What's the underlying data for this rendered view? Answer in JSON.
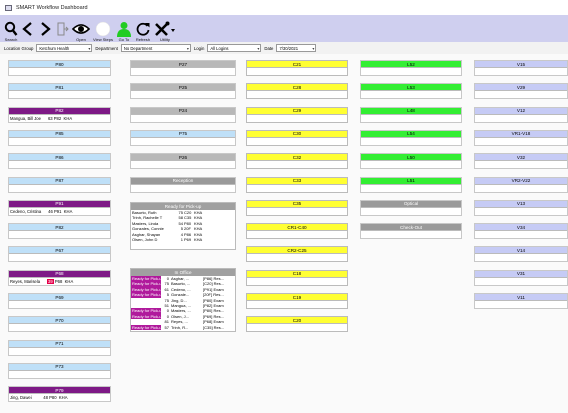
{
  "window": {
    "title": "SMART Workflow Dashboard"
  },
  "toolbar": [
    {
      "name": "search-button",
      "icon": "search-icon",
      "label": "Search"
    },
    {
      "name": "back-button",
      "icon": "chevron-left-icon",
      "label": ""
    },
    {
      "name": "forward-button",
      "icon": "chevron-right-icon",
      "label": ""
    },
    {
      "name": "checkout-button",
      "icon": "door-icon",
      "label": ""
    },
    {
      "name": "open-button",
      "icon": "eye-icon",
      "label": "Open"
    },
    {
      "name": "view-steps-button",
      "icon": "circle-icon",
      "label": "View Steps"
    },
    {
      "name": "go-to-button",
      "icon": "person-icon",
      "label": "Go To"
    },
    {
      "name": "refresh-button",
      "icon": "refresh-icon",
      "label": "Refresh"
    },
    {
      "name": "utility-button",
      "icon": "tools-icon",
      "label": "Utility"
    }
  ],
  "filters": {
    "location_label": "Location Group",
    "location_value": "Ketchum Health",
    "department_label": "Department",
    "department_value": "No Department",
    "login_label": "Login",
    "login_value": "All Logins",
    "date_label": "Date",
    "date_value": "7/30/2021"
  },
  "col1": [
    {
      "name": "P80",
      "color": "blue",
      "detail": ""
    },
    {
      "name": "P81",
      "color": "blue",
      "detail": ""
    },
    {
      "name": "P82",
      "color": "purple",
      "detail": "Mangua, Bill Joe      63 P82  KHA"
    },
    {
      "name": "P85",
      "color": "blue",
      "detail": ""
    },
    {
      "name": "P86",
      "color": "blue",
      "detail": ""
    },
    {
      "name": "P87",
      "color": "blue",
      "detail": ""
    },
    {
      "name": "P91",
      "color": "purple",
      "detail": "Cedeno, Cristina      46 P91  KHA"
    },
    {
      "name": "P82",
      "color": "blue",
      "detail": ""
    },
    {
      "name": "P67",
      "color": "blue",
      "detail": ""
    },
    {
      "name": "P68",
      "color": "purple",
      "detail_pre": "Reyes, Marisela      ",
      "detail_hi": "39",
      "detail_post": " P68  KHA"
    },
    {
      "name": "P69",
      "color": "blue",
      "detail": ""
    },
    {
      "name": "P70",
      "color": "blue",
      "detail": ""
    },
    {
      "name": "P71",
      "color": "blue",
      "detail": ""
    },
    {
      "name": "P73",
      "color": "blue",
      "detail": ""
    },
    {
      "name": "P79",
      "color": "purple",
      "detail": "Jing, Dawei          48 P80  KHA"
    }
  ],
  "col2": [
    {
      "name": "P27",
      "color": "gray"
    },
    {
      "name": "P25",
      "color": "gray"
    },
    {
      "name": "P24",
      "color": "gray"
    },
    {
      "name": "P75",
      "color": "blue"
    },
    {
      "name": "P26",
      "color": "gray"
    },
    {
      "name": "Reception",
      "color": "dgray"
    }
  ],
  "ready_panel": {
    "title": "Ready for Pick-up",
    "rows": [
      [
        "Basurto, Ruth",
        "75",
        "C20",
        "KHA"
      ],
      [
        "Trinh, Rachelle T",
        "58",
        "C35",
        "KHA"
      ],
      [
        "Masters, Linda",
        "54",
        "P80",
        "KHA"
      ],
      [
        "Gonzales, Connie",
        "5",
        "20F",
        "KHA"
      ],
      [
        "Asghar, Shayan",
        "4",
        "P86",
        "KHA"
      ],
      [
        "Olsen, John D",
        "1",
        "P69",
        "KHA"
      ]
    ]
  },
  "office_panel": {
    "title": "In Office",
    "rows": [
      [
        "Ready for Pick-up",
        "0",
        "Asghar, ...",
        "[P86] Res..."
      ],
      [
        "Ready for Pick-up",
        "75",
        "Basurto, ...",
        "[C20] Res..."
      ],
      [
        "Ready for Pick-up",
        "61",
        "Cedeno, ...",
        "[P91] Exam"
      ],
      [
        "Ready for Pick-up",
        "5",
        "Gonzale...",
        "[20F] Res..."
      ],
      [
        "",
        "75",
        "Jing, D...",
        "[P80] Exam"
      ],
      [
        "",
        "51",
        "Mangua, ...",
        "[P82] Exam"
      ],
      [
        "Ready for Pick-up",
        "0",
        "Masters, ...",
        "[P80] Res..."
      ],
      [
        "Ready for Pick-up",
        "0",
        "Olsen, J...",
        "[P69] Res..."
      ],
      [
        "",
        "81",
        "Reyes, ...",
        "[P68] Exam"
      ],
      [
        "Ready for Pick-up",
        "57",
        "Trinh, R...",
        "[C35] Res..."
      ]
    ]
  },
  "col3": [
    {
      "name": "C21",
      "color": "yellow"
    },
    {
      "name": "C28",
      "color": "yellow"
    },
    {
      "name": "C29",
      "color": "yellow"
    },
    {
      "name": "C30",
      "color": "yellow"
    },
    {
      "name": "C32",
      "color": "yellow"
    },
    {
      "name": "C33",
      "color": "yellow"
    },
    {
      "name": "C35",
      "color": "yellow"
    },
    {
      "name": "CR1-C40",
      "color": "yellow"
    },
    {
      "name": "CR2-C25",
      "color": "yellow"
    },
    {
      "name": "C18",
      "color": "yellow"
    },
    {
      "name": "C19",
      "color": "yellow"
    },
    {
      "name": "C20",
      "color": "yellow"
    }
  ],
  "col4": [
    {
      "name": "L52",
      "color": "green"
    },
    {
      "name": "L53",
      "color": "green"
    },
    {
      "name": "L48",
      "color": "green"
    },
    {
      "name": "L54",
      "color": "green"
    },
    {
      "name": "L50",
      "color": "green"
    },
    {
      "name": "L51",
      "color": "green"
    },
    {
      "name": "Optical",
      "color": "dgray"
    },
    {
      "name": "Check-Out",
      "color": "dgray"
    }
  ],
  "col5": [
    {
      "name": "V15",
      "color": "lav"
    },
    {
      "name": "V29",
      "color": "lav"
    },
    {
      "name": "V12",
      "color": "lav"
    },
    {
      "name": "VR1-V18",
      "color": "lav"
    },
    {
      "name": "V32",
      "color": "lav"
    },
    {
      "name": "VR2-V22",
      "color": "lav"
    },
    {
      "name": "V13",
      "color": "lav"
    },
    {
      "name": "V34",
      "color": "lav"
    },
    {
      "name": "V14",
      "color": "lav"
    },
    {
      "name": "V31",
      "color": "lav"
    },
    {
      "name": "V11",
      "color": "lav"
    }
  ]
}
